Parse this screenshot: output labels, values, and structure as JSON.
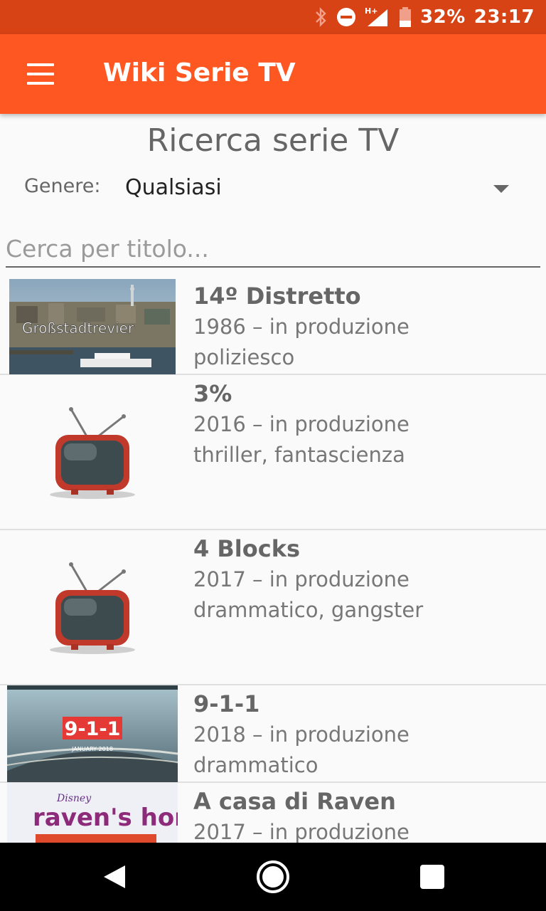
{
  "status_bar": {
    "battery": "32%",
    "time": "23:17",
    "network": "H+",
    "icons": [
      "bluetooth-icon",
      "do-not-disturb-icon",
      "signal-icon",
      "battery-icon"
    ]
  },
  "app_bar": {
    "title": "Wiki Serie TV",
    "menu_icon": "menu-icon"
  },
  "colors": {
    "status_bar": "#d84315",
    "app_bar": "#ff5722",
    "tv_red": "#c0392b"
  },
  "search_panel": {
    "heading": "Ricerca serie TV",
    "genre_label": "Genere:",
    "genre_value": "Qualsiasi",
    "search_placeholder": "Cerca per titolo...",
    "search_value": ""
  },
  "series": [
    {
      "title": "14º Distretto",
      "years": "1986 – in produzione",
      "genres": "poliziesco",
      "thumb_caption": "Großstadtrevier",
      "thumb": "city-harbor-photo"
    },
    {
      "title": "3%",
      "years": "2016 – in produzione",
      "genres": "thriller, fantascienza",
      "thumb": "tv-placeholder-icon"
    },
    {
      "title": "4 Blocks",
      "years": "2017 – in produzione",
      "genres": "drammatico, gangster",
      "thumb": "tv-placeholder-icon"
    },
    {
      "title": "9-1-1",
      "years": "2018 – in produzione",
      "genres": "drammatico",
      "thumb_caption": "9-1-1",
      "thumb_subcaption": "JANUARY 2018",
      "thumb": "highway-poster"
    },
    {
      "title": "A casa di Raven",
      "years": "2017 – in produzione",
      "genres": "",
      "thumb_caption": "raven's home",
      "thumb_brand": "Disney",
      "thumb": "ravens-home-poster"
    }
  ]
}
